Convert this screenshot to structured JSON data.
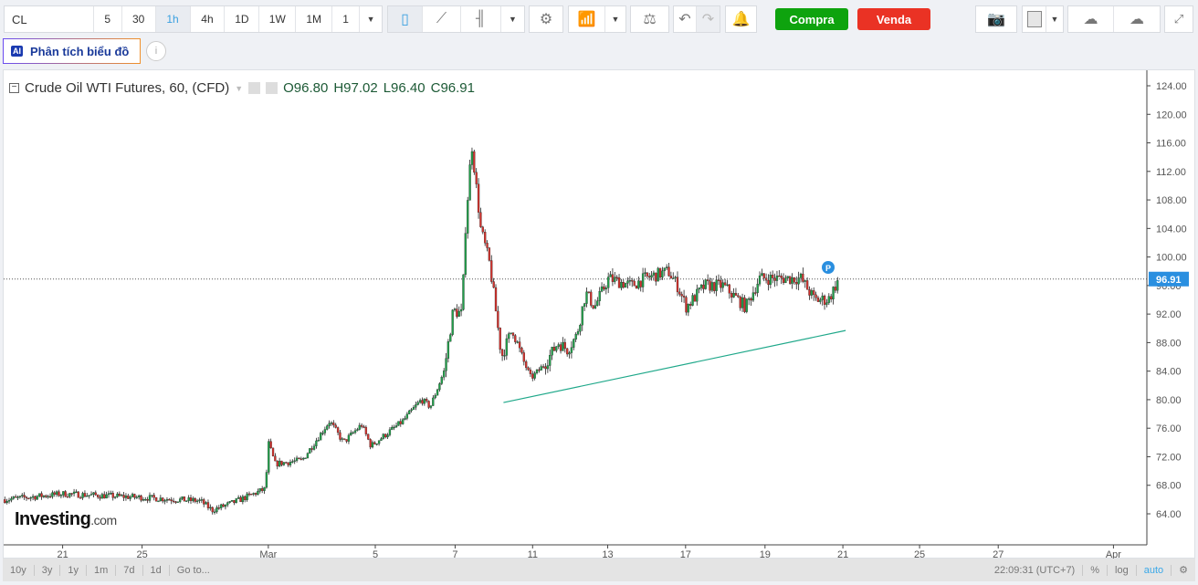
{
  "toolbar": {
    "symbol": "CL",
    "intervals": [
      "5",
      "30",
      "1h",
      "4h",
      "1D",
      "1W",
      "1M",
      "1"
    ],
    "selected_interval": "1h",
    "buy": "Compra",
    "sell": "Venda"
  },
  "ai_button": {
    "label": "Phân tích biểu đồ",
    "badge": "AI",
    "info": "i"
  },
  "legend": {
    "title": "Crude Oil WTI Futures, 60, (CFD)",
    "open": "O96.80",
    "high": "H97.02",
    "low": "L96.40",
    "close": "C96.91"
  },
  "price_label": "96.91",
  "marker": "P",
  "watermark": "Investing.com",
  "bottom": {
    "ranges": [
      "10y",
      "3y",
      "1y",
      "1m",
      "7d",
      "1d",
      "Go to..."
    ],
    "time": "22:09:31 (UTC+7)",
    "percent": "%",
    "log": "log",
    "auto": "auto"
  },
  "colors": {
    "up": "#20a04a",
    "down": "#d4312c",
    "buy": "#0ea30e",
    "sell": "#ea3224",
    "accent": "#2a8fe0"
  },
  "chart_data": {
    "type": "candlestick",
    "title": "Crude Oil WTI Futures, 60, (CFD)",
    "x_unit": "trading days from Feb 21",
    "ylim": [
      61,
      126
    ],
    "xlim": [
      -1.5,
      27.5
    ],
    "y_ticks": [
      64,
      68,
      72,
      76,
      80,
      84,
      88,
      92,
      96,
      100,
      104,
      108,
      112,
      116,
      120,
      124
    ],
    "x_ticks": [
      {
        "label": "21",
        "t": 0
      },
      {
        "label": "25",
        "t": 2.02
      },
      {
        "label": "Mar",
        "t": 5.23
      },
      {
        "label": "5",
        "t": 7.95
      },
      {
        "label": "7",
        "t": 9.98
      },
      {
        "label": "11",
        "t": 11.95
      },
      {
        "label": "13",
        "t": 13.86
      },
      {
        "label": "17",
        "t": 15.84
      },
      {
        "label": "19",
        "t": 17.86
      },
      {
        "label": "21",
        "t": 19.84
      },
      {
        "label": "25",
        "t": 21.79
      },
      {
        "label": "27",
        "t": 23.79
      },
      {
        "label": "Apr",
        "t": 26.72
      }
    ],
    "price_path": [
      [
        -1.47,
        66
      ],
      [
        0,
        66.8
      ],
      [
        2,
        66.3
      ],
      [
        3.5,
        65.8
      ],
      [
        3.8,
        64.5
      ],
      [
        4.3,
        65.5
      ],
      [
        5.16,
        67.5
      ],
      [
        5.23,
        74
      ],
      [
        5.4,
        71
      ],
      [
        6.09,
        71.5
      ],
      [
        6.79,
        77
      ],
      [
        7.14,
        74
      ],
      [
        7.6,
        76.5
      ],
      [
        7.84,
        73.5
      ],
      [
        8.65,
        77
      ],
      [
        9.12,
        80
      ],
      [
        9.35,
        79
      ],
      [
        9.7,
        84
      ],
      [
        9.93,
        92.5
      ],
      [
        10.16,
        92
      ],
      [
        10.23,
        103
      ],
      [
        10.4,
        116
      ],
      [
        10.63,
        104
      ],
      [
        10.86,
        99
      ],
      [
        10.98,
        94
      ],
      [
        11.16,
        86
      ],
      [
        11.44,
        90
      ],
      [
        11.67,
        86
      ],
      [
        11.91,
        83
      ],
      [
        12.26,
        85
      ],
      [
        12.6,
        88
      ],
      [
        12.84,
        87
      ],
      [
        13.07,
        89
      ],
      [
        13.3,
        95
      ],
      [
        13.53,
        93
      ],
      [
        13.88,
        97
      ],
      [
        14.47,
        96
      ],
      [
        14.81,
        97
      ],
      [
        15.4,
        98
      ],
      [
        15.63,
        96
      ],
      [
        15.86,
        93
      ],
      [
        16.33,
        96
      ],
      [
        16.79,
        96
      ],
      [
        17.37,
        93
      ],
      [
        17.72,
        97
      ],
      [
        18.19,
        97
      ],
      [
        18.77,
        97
      ],
      [
        19.12,
        94
      ],
      [
        19.47,
        94
      ],
      [
        19.74,
        96.91
      ]
    ],
    "last_price": 96.91,
    "trendline": [
      [
        11.21,
        79.6
      ],
      [
        19.91,
        89.7
      ]
    ]
  }
}
